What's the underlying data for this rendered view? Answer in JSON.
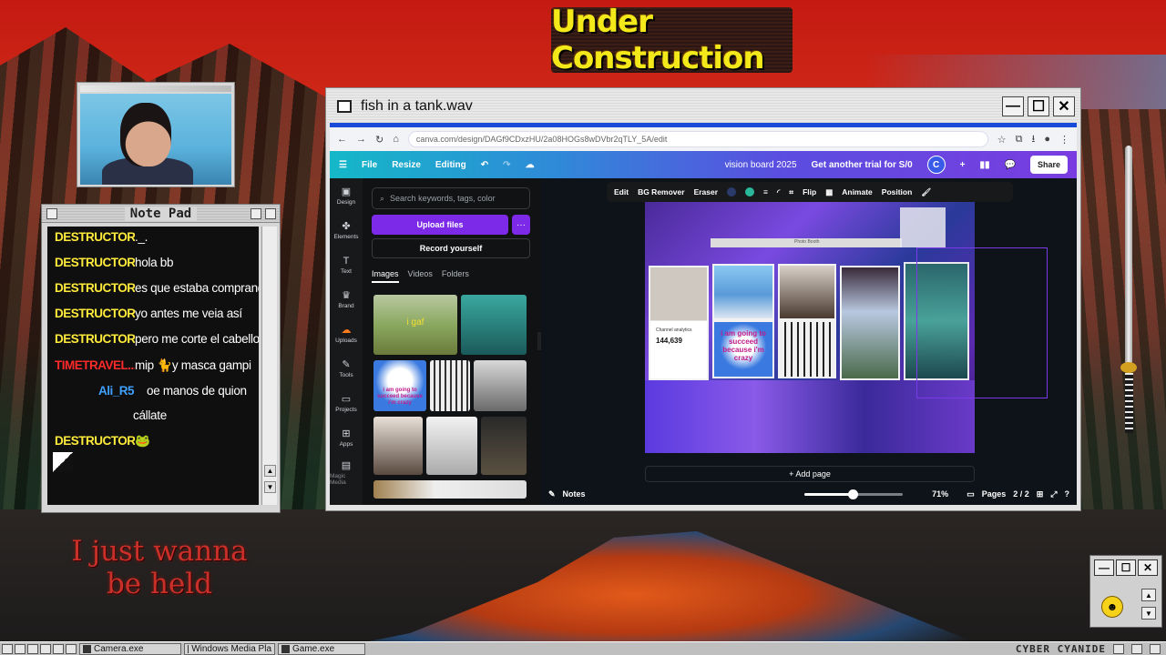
{
  "banner": {
    "text": "Under Construction"
  },
  "notepad": {
    "title": "Note Pad",
    "messages": [
      {
        "user": "DESTRUCTOR...",
        "text": "._."
      },
      {
        "user": "DESTRUCTOR...",
        "text": "hola bb"
      },
      {
        "user": "DESTRUCTOR...",
        "text": "es que estaba comprando"
      },
      {
        "user": "DESTRUCTOR...",
        "text": "yo antes me veia así"
      },
      {
        "user": "DESTRUCTOR...",
        "text": "pero me corte el cabello"
      },
      {
        "user": "TIMETRAVEL...",
        "text": "mip 🐈y masca gampi"
      },
      {
        "user": "Ali_R5",
        "text": "oe manos de quion"
      },
      {
        "user": "",
        "text": "cállate"
      },
      {
        "user": "DESTRUCTOR...",
        "text": "🐸"
      }
    ]
  },
  "overlay_text": {
    "line1": "I just wanna",
    "line2": "be held"
  },
  "window": {
    "title": "fish in a tank.wav"
  },
  "browser": {
    "url": "canva.com/design/DAGf9CDxzHU/2a08HOGs8wDVbr2qTLY_5A/edit"
  },
  "canva": {
    "menu": {
      "file": "File",
      "resize": "Resize",
      "editing": "Editing"
    },
    "design_title": "vision board 2025",
    "trial": "Get another trial for S/0",
    "avatar": "C",
    "share": "Share",
    "sidebar": [
      "Design",
      "Elements",
      "Text",
      "Brand",
      "Uploads",
      "Tools",
      "Projects",
      "Apps",
      "Magic Media"
    ],
    "search_placeholder": "Search keywords, tags, color",
    "upload_button": "Upload files",
    "record_button": "Record yourself",
    "tabs": [
      "Images",
      "Videos",
      "Folders"
    ],
    "thumb_caption_1": "i gaf",
    "thumb_caption_2": "i am going to succeed because i'm crazy",
    "toolbar": [
      "Edit",
      "BG Remover",
      "Eraser",
      "Flip",
      "Animate",
      "Position"
    ],
    "board_text": {
      "analytics_label": "Channel analytics",
      "analytics_value": "144,639",
      "quote": "i am going to succeed because i'm crazy",
      "photo_booth": "Photo Booth"
    },
    "add_page": "+ Add page",
    "notes": "Notes",
    "zoom": "71%",
    "zoom_level": 0.49,
    "pages_label": "Pages",
    "page_count": "2 / 2"
  },
  "taskbar": {
    "items": [
      "Camera.exe",
      "Windows Media Pla",
      "Game.exe"
    ],
    "brand": "CYBER CYANIDE"
  },
  "colors": {
    "accent": "#7d2ae8",
    "chat_user": "#ffeb3b",
    "chat_user_alt": "#ff2a2a",
    "chat_user_blue": "#3fa0ff"
  }
}
